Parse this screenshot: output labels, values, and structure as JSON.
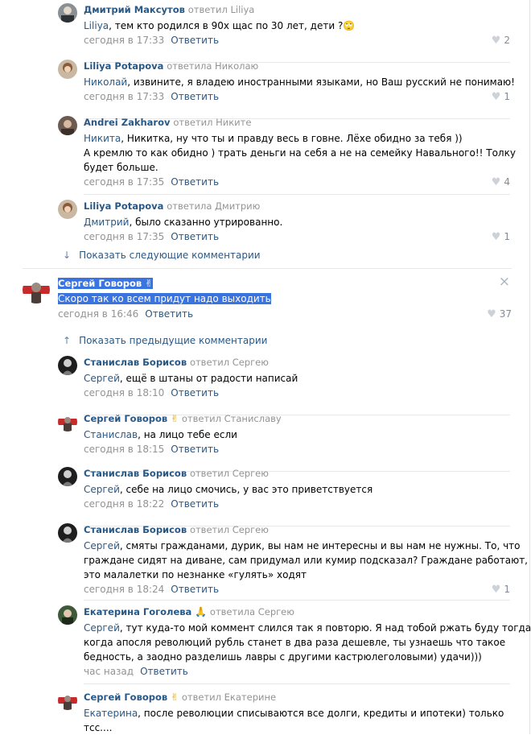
{
  "top_replies": [
    {
      "author": "Дмитрий Максутов",
      "reply_to": "ответил Liliya",
      "mention": "Liliya",
      "text": ", тем кто родился в 90х щас по 30 лет, дети ?",
      "emoji": "🙄",
      "date": "сегодня в 17:33",
      "action": "Ответить",
      "likes": "2"
    },
    {
      "author": "Liliya Potapova",
      "reply_to": "ответила Николаю",
      "mention": "Николай",
      "text": ", извините, я владею иностранными языками, но Ваш русский не понимаю!",
      "date": "сегодня в 17:33",
      "action": "Ответить",
      "likes": "1"
    },
    {
      "author": "Andrei Zakharov",
      "reply_to": "ответил Никите",
      "mention": "Никита",
      "text": ", Никитка, ну что ты и правду весь в говне. Лёхе обидно за тебя ))",
      "extra_lines": [
        "А кремлю то как обидно ) трать деньги на себя а не на семейку Навального!! Толку",
        "будет больше."
      ],
      "date": "сегодня в 17:35",
      "action": "Ответить",
      "likes": "4"
    },
    {
      "author": "Liliya Potapova",
      "reply_to": "ответила Дмитрию",
      "mention": "Дмитрий",
      "text": ", было сказанно утрированно.",
      "date": "сегодня в 17:35",
      "action": "Ответить",
      "likes": "1"
    }
  ],
  "show_next": "Показать следующие комментарии",
  "main_comment": {
    "author": "Сергей Говоров",
    "emoji": "✌",
    "text": "Скоро так ко всем придут надо выходить",
    "date": "сегодня в 16:46",
    "action": "Ответить",
    "likes": "37",
    "close": "×"
  },
  "show_prev": "Показать предыдущие комментарии",
  "bottom_replies": [
    {
      "author": "Станислав Борисов",
      "reply_to": "ответил Сергею",
      "mention": "Сергей",
      "text": ", ещё в штаны от радости написай",
      "date": "сегодня в 18:10",
      "action": "Ответить"
    },
    {
      "author": "Сергей Говоров",
      "emoji": "✌",
      "reply_to": "ответил Станиславу",
      "mention": "Станислав",
      "text": ", на лицо тебе если",
      "date": "сегодня в 18:15",
      "action": "Ответить"
    },
    {
      "author": "Станислав Борисов",
      "reply_to": "ответил Сергею",
      "mention": "Сергей",
      "text": ", себе на лицо смочись, у вас это приветствуется",
      "date": "сегодня в 18:22",
      "action": "Ответить"
    },
    {
      "author": "Станислав Борисов",
      "reply_to": "ответил Сергею",
      "mention": "Сергей",
      "text": ", смяты гражданами, дурик, вы нам не интересны и вы нам не нужны. То, что",
      "extra_lines": [
        "граждане сидят на диване, сам придумал или кумир подсказал? Граждане работают,",
        "это малалетки по незнанке «гулять» ходят"
      ],
      "date": "сегодня в 18:24",
      "action": "Ответить",
      "likes": "1"
    },
    {
      "author": "Екатерина Гоголева",
      "emoji": "🙏",
      "reply_to": "ответила Сергею",
      "mention": "Сергей",
      "text": ", тут куда-то мой коммент слился так я повторю. Я над тобой ржать буду тогда",
      "extra_lines": [
        "когда апосля революций рубль станет в два раза дешевле, ты узнаешь что такое",
        "бедность, а заодно разделишь лавры с другими кастрюлеголовыми) удачи)))"
      ],
      "date": "час назад",
      "action": "Ответить"
    },
    {
      "author": "Сергей Говоров",
      "emoji": "✌",
      "reply_to": "ответил Екатерине",
      "mention": "Екатерина",
      "text": ", после революции списываются все долги, кредиты и ипотеки) только",
      "extra_lines": [
        "тсс...."
      ]
    }
  ],
  "colors": {
    "link": "#2a5885",
    "muted": "#939393",
    "selection": "#3a74e0",
    "separator": "#e7e8ec"
  }
}
